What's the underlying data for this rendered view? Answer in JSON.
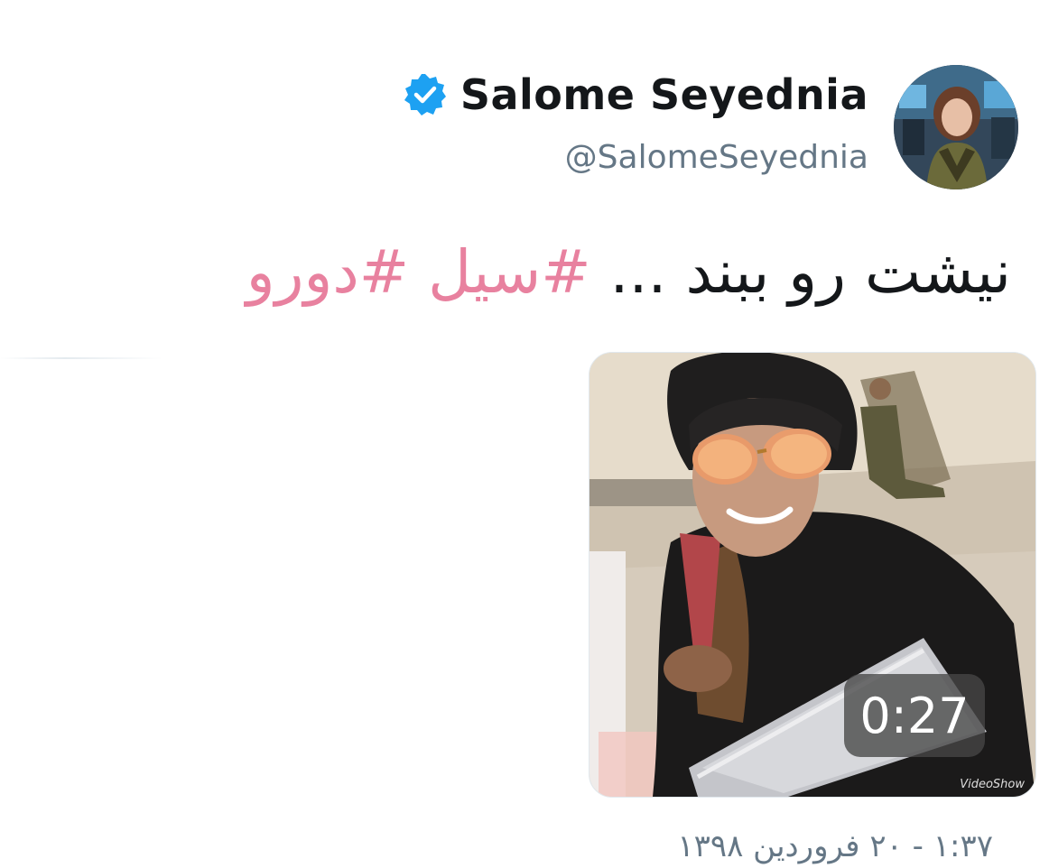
{
  "author": {
    "display_name": "Salome Seyednia",
    "handle": "@SalomeSeyednia",
    "verified": true,
    "avatar": "profile-photo"
  },
  "tweet": {
    "text_plain": "نیشت رو ببند ...",
    "hashtags": [
      "#سیل",
      "#دورو"
    ],
    "hashtag_color": "#e8819f"
  },
  "media": {
    "type": "video",
    "duration": "0:27",
    "watermark": "VideoShow"
  },
  "timestamp": "۱:۳۷ - ۲۰ فروردین ۱۳۹۸",
  "colors": {
    "verified_badge": "#1da1f2",
    "text_primary": "#14171a",
    "text_secondary": "#657786"
  }
}
